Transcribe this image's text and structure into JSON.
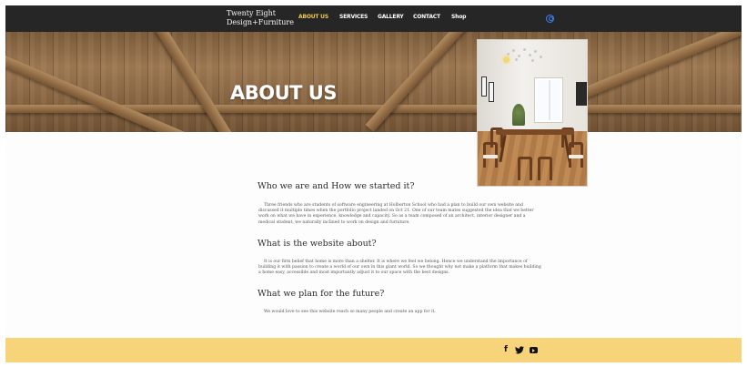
{
  "header": {
    "brand_line1": "Twenty Eight",
    "brand_line2": "Design+Furniture",
    "nav": [
      {
        "label": "ABOUT US",
        "active": true
      },
      {
        "label": "SERVICES",
        "active": false
      },
      {
        "label": "GALLERY",
        "active": false
      },
      {
        "label": "CONTACT",
        "active": false
      },
      {
        "label": "Shop",
        "active": false
      }
    ],
    "icon": "user-login-icon"
  },
  "hero": {
    "title": "ABOUT US",
    "image": "dining-room-photo"
  },
  "sections": [
    {
      "heading": "Who we are and How we started it?",
      "text": "Three friends who are students of software engineering at Holberton School who had a plan to build our own website and discussed it multiple times when the portfolio project landed on Oct 21. One of our team mates suggested the idea that we better work on what we have in experience, knowledge and capacity. So as a team composed of an architect, interior designer and a medical student, we naturally inclined to work on design and furniture."
    },
    {
      "heading": "What is the website about?",
      "text": "It is our firm belief that home is more than a shelter. It is where we feel we belong. Hence we understand the importance of building it with passion to create a world of our own in this giant world.  So we thought why not make a platform that makes building a home easy, accessible and most importantly adjust it to our space with the best designs."
    },
    {
      "heading": "What we plan for the future?",
      "text": "We would love to see this website reach so many people and create an app for it."
    }
  ],
  "footer": {
    "social": [
      "facebook-icon",
      "twitter-icon",
      "youtube-icon"
    ],
    "facebook_glyph": "f",
    "twitter_glyph": "🐦"
  },
  "colors": {
    "header_bg": "#262626",
    "nav_active": "#f2c94c",
    "footer_bg": "#f7d37a",
    "login_icon": "#3b82f6"
  }
}
